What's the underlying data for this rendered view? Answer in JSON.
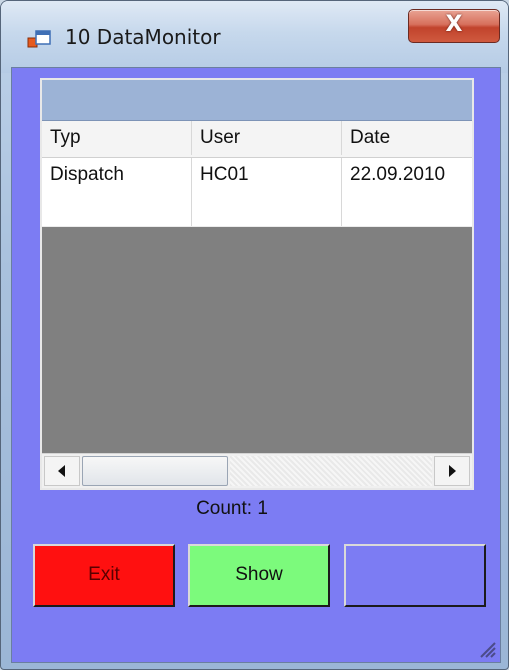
{
  "window": {
    "title": "10 DataMonitor",
    "close_label": "X"
  },
  "grid": {
    "columns": [
      "Typ",
      "User",
      "Date"
    ],
    "rows": [
      [
        "Dispatch",
        "HC01",
        "22.09.2010"
      ]
    ]
  },
  "status": {
    "count_text": "Count: 1"
  },
  "buttons": {
    "exit_label": "Exit",
    "show_label": "Show",
    "third_label": ""
  },
  "colors": {
    "client_background": "#7c7cf3",
    "exit_button": "#ff1010",
    "show_button": "#7cfa7c",
    "grid_caption": "#9cb3d6"
  },
  "icons": {
    "app": "form-window-icon",
    "close": "close-icon",
    "scroll_left": "scroll-left-arrow-icon",
    "scroll_right": "scroll-right-arrow-icon",
    "resize": "size-grip-icon"
  }
}
